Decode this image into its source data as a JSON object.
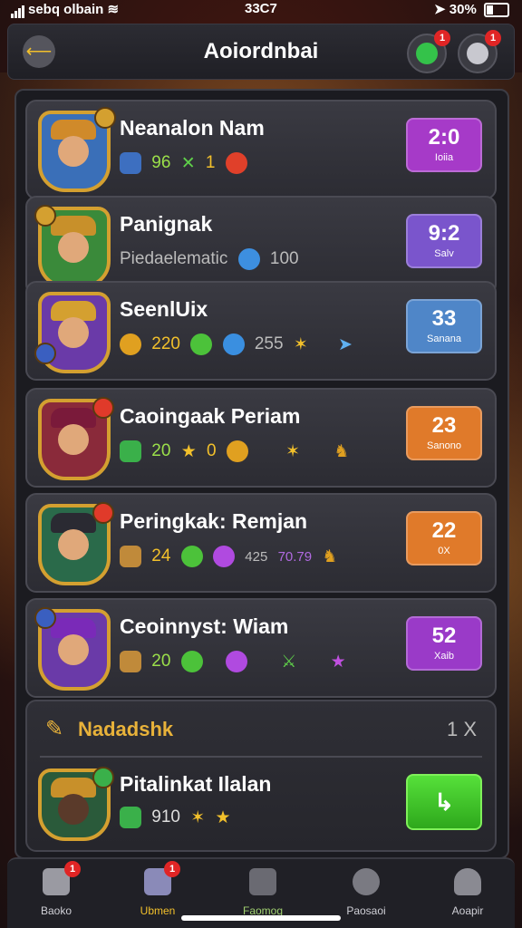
{
  "status_bar": {
    "left": "sebq olbain",
    "time": "33C7",
    "battery": "30%"
  },
  "header": {
    "title": "Aoiordnbai",
    "badge_left": "1",
    "badge_right": "1"
  },
  "rows": [
    {
      "name": "Neanalon Nam",
      "stat_a": "96",
      "stat_b": "1",
      "rank": "2:0",
      "rank_label": "Ioiia"
    },
    {
      "name": "Panignak",
      "subtitle": "Piedaelematic",
      "stat_a": "100",
      "rank": "9:2",
      "rank_label": "Salv"
    },
    {
      "name": "SeenlUix",
      "stat_a": "220",
      "stat_b": "255",
      "rank": "33",
      "rank_label": "Sanana"
    },
    {
      "name": "Caoingaak Periam",
      "stat_a": "20",
      "stat_b": "0",
      "rank": "23",
      "rank_label": "Sanono"
    },
    {
      "name": "Peringkak: Remjan",
      "stat_a": "24",
      "stat_b": "425",
      "stat_c": "70.79",
      "rank": "22",
      "rank_label": "0X"
    },
    {
      "name": "Ceoinnyst: Wiam",
      "stat_a": "20",
      "rank": "52",
      "rank_label": "Xaib"
    }
  ],
  "section": {
    "title": "Nadadshk",
    "count": "1 X",
    "row_name": "Pitalinkat Ilalan",
    "row_stat": "910",
    "button_icon": "↳"
  },
  "tabs": [
    {
      "label": "Baoko",
      "badge": "1"
    },
    {
      "label": "Ubmen",
      "badge": "1"
    },
    {
      "label": "Faomog"
    },
    {
      "label": "Paosaoi"
    },
    {
      "label": "Aoapir"
    }
  ],
  "colors": {
    "rank1": "#a63ac8",
    "rank2": "#7a55cc",
    "rank3": "#4f86c8",
    "rank4": "#e07a2a",
    "rank5": "#e07a2a",
    "rank6": "#9a3ac8"
  }
}
